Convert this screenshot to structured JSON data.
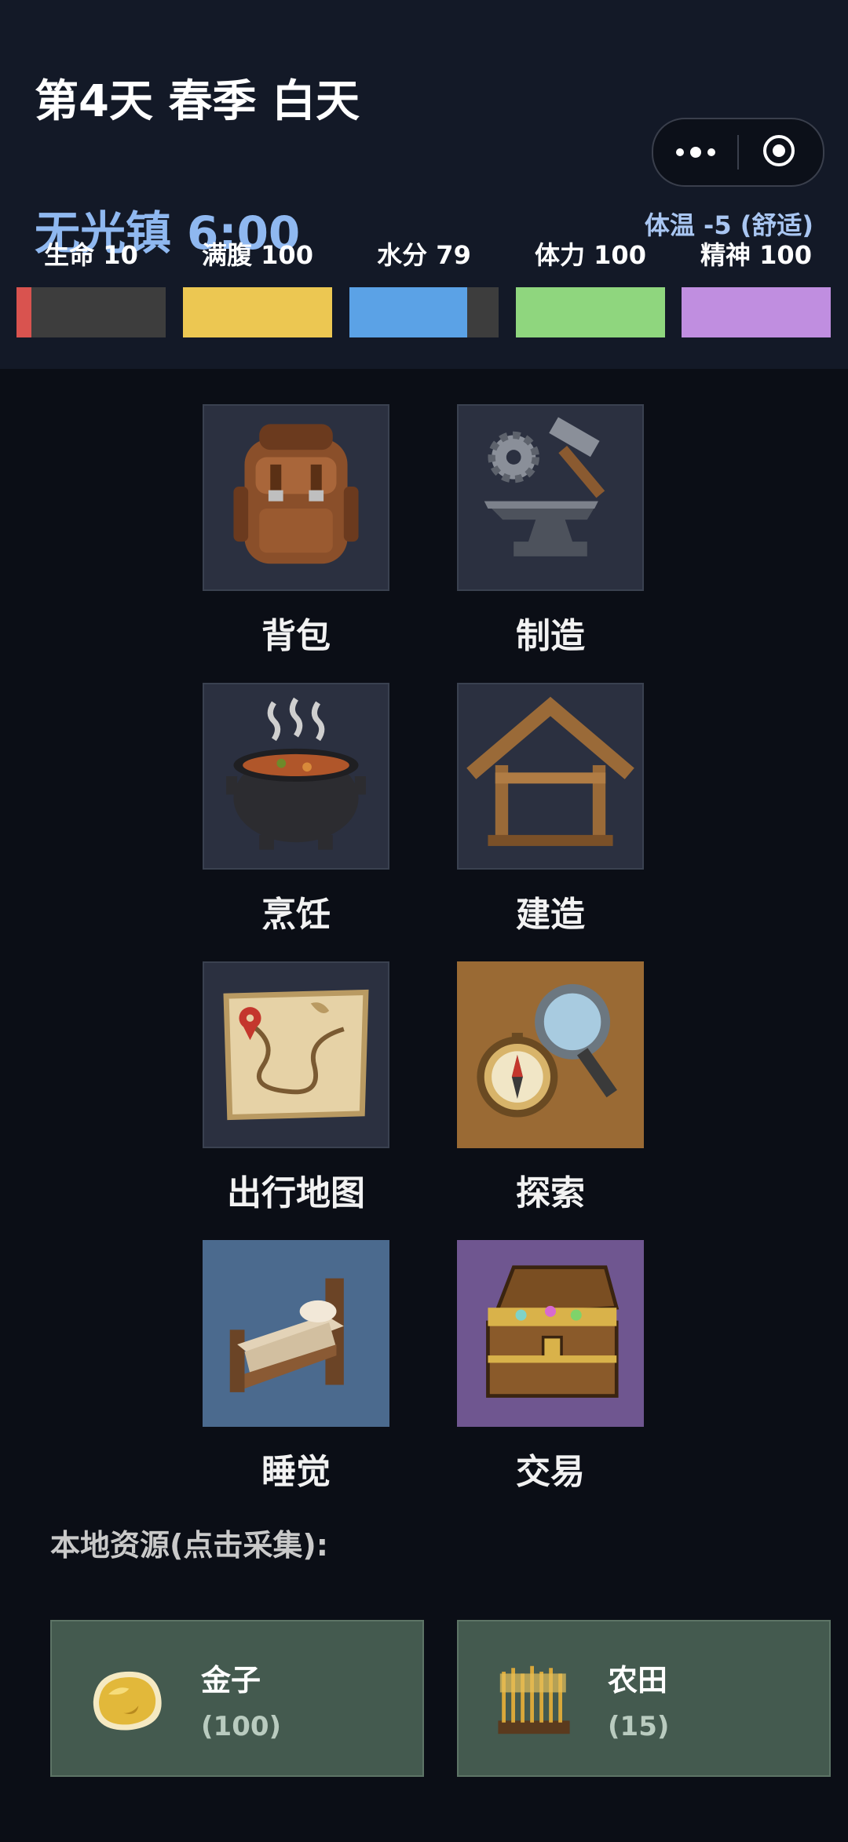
{
  "header": {
    "day_title": "第4天 春季 白天",
    "location": "无光镇",
    "time": "6:00",
    "temperature": "体温 -5 (舒适)"
  },
  "stats": [
    {
      "label": "生命 10",
      "value": 10,
      "color": "#d9534f"
    },
    {
      "label": "满腹 100",
      "value": 100,
      "color": "#ecc752"
    },
    {
      "label": "水分 79",
      "value": 79,
      "color": "#5ba2e6"
    },
    {
      "label": "体力 100",
      "value": 100,
      "color": "#8fd67e"
    },
    {
      "label": "精神 100",
      "value": 100,
      "color": "#c08ee0"
    }
  ],
  "actions": [
    {
      "label": "背包",
      "icon": "backpack-icon"
    },
    {
      "label": "制造",
      "icon": "anvil-hammer-icon"
    },
    {
      "label": "烹饪",
      "icon": "cooking-pot-icon"
    },
    {
      "label": "建造",
      "icon": "wooden-frame-icon"
    },
    {
      "label": "出行地图",
      "icon": "treasure-map-icon"
    },
    {
      "label": "探索",
      "icon": "compass-magnifier-icon"
    },
    {
      "label": "睡觉",
      "icon": "bed-icon"
    },
    {
      "label": "交易",
      "icon": "treasure-chest-icon"
    }
  ],
  "resources": {
    "title": "本地资源(点击采集):",
    "items": [
      {
        "name": "金子",
        "count": "(100)",
        "icon": "gold-nugget-icon"
      },
      {
        "name": "农田",
        "count": "(15)",
        "icon": "wheat-field-icon"
      }
    ]
  }
}
